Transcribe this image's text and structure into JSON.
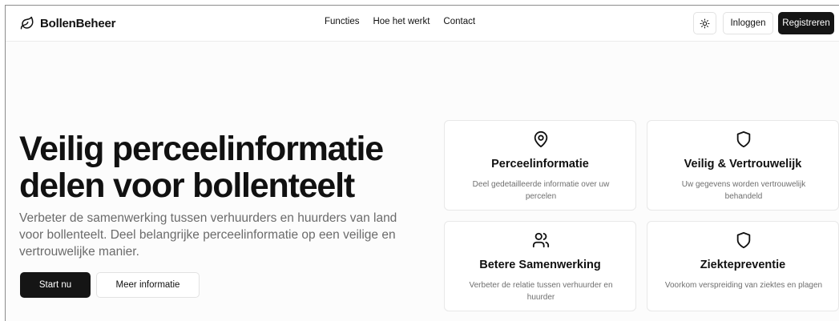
{
  "header": {
    "brand": "BollenBeheer",
    "nav": [
      "Functies",
      "Hoe het werkt",
      "Contact"
    ],
    "login": "Inloggen",
    "register": "Registreren",
    "theme_icon": "sun-icon"
  },
  "hero": {
    "title": "Veilig perceelinformatie delen voor bollenteelt",
    "subtitle": "Verbeter de samenwerking tussen verhuurders en huurders van land voor bollenteelt. Deel belangrijke perceelinformatie op een veilige en vertrouwelijke manier.",
    "primary": "Start nu",
    "secondary": "Meer informatie"
  },
  "features": [
    {
      "icon": "map-pin-icon",
      "title": "Perceelinformatie",
      "desc": "Deel gedetailleerde informatie over uw percelen"
    },
    {
      "icon": "shield-icon",
      "title": "Veilig & Vertrouwelijk",
      "desc": "Uw gegevens worden vertrouwelijk behandeld"
    },
    {
      "icon": "users-icon",
      "title": "Betere Samenwerking",
      "desc": "Verbeter de relatie tussen verhuurder en huurder"
    },
    {
      "icon": "shield-icon",
      "title": "Ziektepreventie",
      "desc": "Voorkom verspreiding van ziektes en plagen"
    }
  ],
  "colors": {
    "primary_button": "#151515",
    "muted_text": "#6b6b6b",
    "border": "#e2e2e2"
  }
}
